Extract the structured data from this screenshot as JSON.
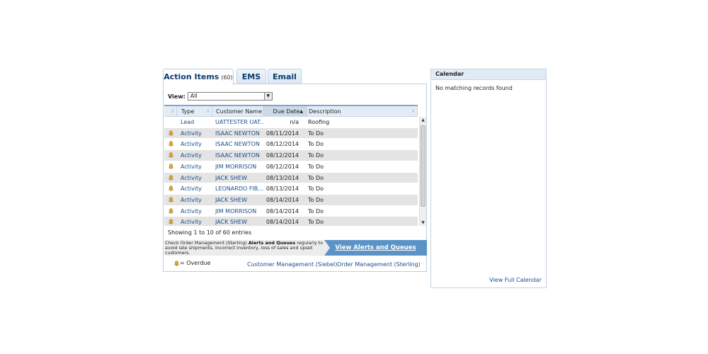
{
  "tabs": [
    {
      "label": "Action Items",
      "count": "(60)"
    },
    {
      "label": "EMS"
    },
    {
      "label": "Email"
    }
  ],
  "view": {
    "label": "View:",
    "selected": "All"
  },
  "columns": {
    "type": "Type",
    "customer": "Customer Name",
    "due": "Due Date",
    "description": "Description"
  },
  "rows": [
    {
      "icon": "",
      "type": "Lead",
      "customer": "UATTESTER UAT...",
      "due": "n/a",
      "description": "Roofing"
    },
    {
      "icon": "overdue-bell-icon",
      "type": "Activity",
      "customer": "ISAAC NEWTON",
      "due": "08/11/2014",
      "description": "To Do"
    },
    {
      "icon": "overdue-bell-icon",
      "type": "Activity",
      "customer": "ISAAC NEWTON",
      "due": "08/12/2014",
      "description": "To Do"
    },
    {
      "icon": "overdue-bell-icon",
      "type": "Activity",
      "customer": "ISAAC NEWTON",
      "due": "08/12/2014",
      "description": "To Do"
    },
    {
      "icon": "overdue-bell-icon",
      "type": "Activity",
      "customer": "JIM MORRISON",
      "due": "08/12/2014",
      "description": "To Do"
    },
    {
      "icon": "overdue-bell-icon",
      "type": "Activity",
      "customer": "JACK SHEW",
      "due": "08/13/2014",
      "description": "To Do"
    },
    {
      "icon": "overdue-bell-icon",
      "type": "Activity",
      "customer": "LEONARDO FIB...",
      "due": "08/13/2014",
      "description": "To Do"
    },
    {
      "icon": "overdue-bell-icon",
      "type": "Activity",
      "customer": "JACK SHEW",
      "due": "08/14/2014",
      "description": "To Do"
    },
    {
      "icon": "overdue-bell-icon",
      "type": "Activity",
      "customer": "JIM MORRISON",
      "due": "08/14/2014",
      "description": "To Do"
    },
    {
      "icon": "overdue-bell-icon",
      "type": "Activity",
      "customer": "JACK SHEW",
      "due": "08/14/2014",
      "description": "To Do"
    }
  ],
  "showing": "Showing 1 to 10 of 60 entries",
  "promo": {
    "text_before": "Check Order Management (Sterling)",
    "text_bold": "Alerts and Queues",
    "text_after": "regularly to avoid late shipments, incorrect inventory, loss of sales and upset customers.",
    "link": "View Alerts and Queues"
  },
  "legend": {
    "label": "= Overdue"
  },
  "footer_links": [
    "Customer Management (Siebel)",
    "Order Management (Sterling)"
  ],
  "calendar": {
    "title": "Calendar",
    "empty": "No matching records found",
    "link": "View Full Calendar"
  },
  "colors": {
    "link": "#1a4f8b",
    "tab_text": "#0d3c6e",
    "promo_bg": "#5b93c7",
    "row_alt": "#e4e4e4",
    "bell": "#d8a43c"
  }
}
